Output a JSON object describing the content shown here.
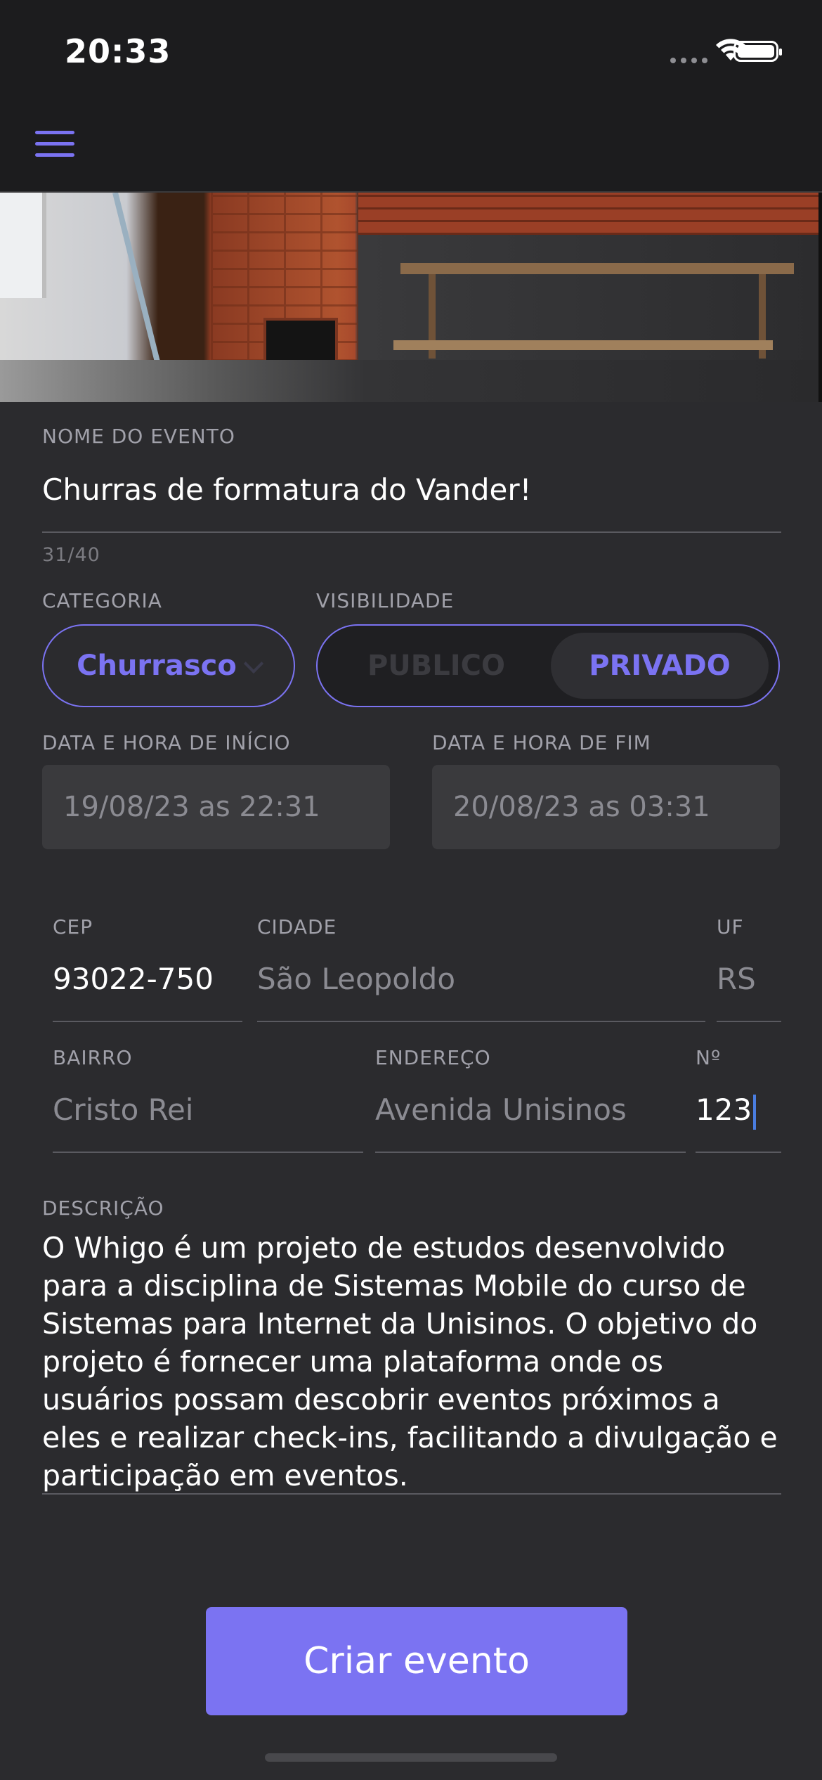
{
  "status_bar": {
    "time": "20:33"
  },
  "form": {
    "event_name": {
      "label": "NOME DO EVENTO",
      "value": "Churras de formatura do Vander!",
      "counter": "31/40"
    },
    "category": {
      "label": "CATEGORIA",
      "value": "Churrasco"
    },
    "visibility": {
      "label": "VISIBILIDADE",
      "options": [
        "PUBLICO",
        "PRIVADO"
      ],
      "selected": "PRIVADO"
    },
    "start": {
      "label": "DATA E HORA DE INÍCIO",
      "value": "19/08/23 as 22:31"
    },
    "end": {
      "label": "DATA E HORA DE FIM",
      "value": "20/08/23 as 03:31"
    },
    "cep": {
      "label": "CEP",
      "value": "93022-750"
    },
    "city": {
      "label": "CIDADE",
      "value": "São Leopoldo"
    },
    "uf": {
      "label": "UF",
      "value": "RS"
    },
    "neighborhood": {
      "label": "BAIRRO",
      "value": "Cristo Rei"
    },
    "address": {
      "label": "ENDEREÇO",
      "value": "Avenida Unisinos"
    },
    "number": {
      "label": "Nº",
      "value": "123"
    },
    "description": {
      "label": "DESCRIÇÃO",
      "value": "O Whigo é um projeto de estudos desenvolvido para a disciplina de Sistemas Mobile do curso de Sistemas para Internet da Unisinos. O objetivo do projeto é fornecer uma plataforma onde os usuários possam descobrir eventos próximos a eles e realizar check-ins, facilitando a divulgação e participação em eventos."
    }
  },
  "actions": {
    "submit_label": "Criar evento"
  },
  "colors": {
    "accent": "#7b73f2",
    "background": "#2b2b2e",
    "topbar": "#1c1c1e"
  },
  "icons": {
    "menu": "hamburger-menu-icon"
  }
}
